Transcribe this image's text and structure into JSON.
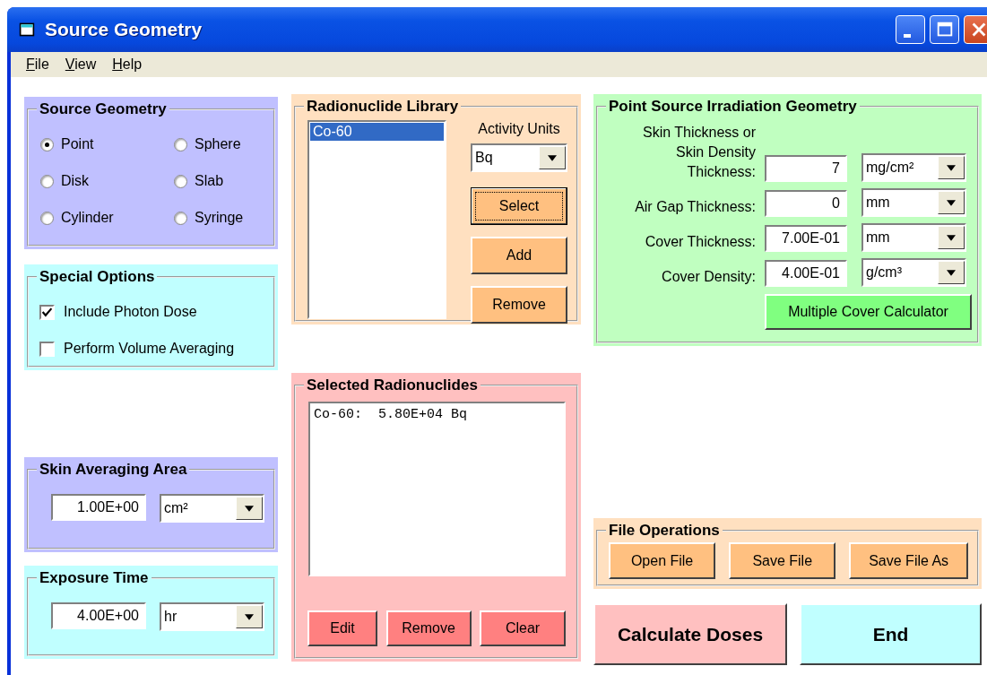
{
  "window": {
    "title": "Source Geometry"
  },
  "menu": [
    {
      "label": "File"
    },
    {
      "label": "View"
    },
    {
      "label": "Help"
    }
  ],
  "source_geometry": {
    "title": "Source Geometry",
    "options": [
      {
        "label": "Point",
        "selected": true
      },
      {
        "label": "Sphere",
        "selected": false
      },
      {
        "label": "Disk",
        "selected": false
      },
      {
        "label": "Slab",
        "selected": false
      },
      {
        "label": "Cylinder",
        "selected": false
      },
      {
        "label": "Syringe",
        "selected": false
      }
    ]
  },
  "special_options": {
    "title": "Special Options",
    "options": [
      {
        "label": "Include Photon Dose",
        "checked": true
      },
      {
        "label": "Perform Volume Averaging",
        "checked": false
      }
    ]
  },
  "skin_averaging_area": {
    "title": "Skin Averaging Area",
    "value": "1.00E+00",
    "unit": "cm²"
  },
  "exposure_time": {
    "title": "Exposure Time",
    "value": "4.00E+00",
    "unit": "hr"
  },
  "radionuclide_library": {
    "title": "Radionuclide Library",
    "items": [
      {
        "label": "Co-60",
        "selected": true
      }
    ],
    "activity_units_label": "Activity Units",
    "activity_units": "Bq",
    "buttons": [
      {
        "label": "Select",
        "focused": true
      },
      {
        "label": "Add",
        "focused": false
      },
      {
        "label": "Remove",
        "focused": false
      }
    ]
  },
  "selected_radionuclides": {
    "title": "Selected Radionuclides",
    "lines": [
      "Co-60:  5.80E+04 Bq"
    ],
    "buttons": [
      {
        "label": "Edit"
      },
      {
        "label": "Remove"
      },
      {
        "label": "Clear"
      }
    ]
  },
  "point_source": {
    "title": "Point Source Irradiation Geometry",
    "rows": [
      {
        "label": "Skin Thickness or\nSkin Density\nThickness:",
        "value": "7",
        "unit": "mg/cm²"
      },
      {
        "label": "Air Gap Thickness:",
        "value": "0",
        "unit": "mm"
      },
      {
        "label": "Cover Thickness:",
        "value": "7.00E-01",
        "unit": "mm"
      },
      {
        "label": "Cover Density:",
        "value": "4.00E-01",
        "unit": "g/cm³"
      }
    ],
    "button": "Multiple Cover Calculator"
  },
  "file_operations": {
    "title": "File Operations",
    "buttons": [
      {
        "label": "Open File"
      },
      {
        "label": "Save File"
      },
      {
        "label": "Save File As"
      }
    ]
  },
  "actions": [
    {
      "label": "Calculate Doses",
      "kind": "calculate"
    },
    {
      "label": "End",
      "kind": "end"
    }
  ]
}
